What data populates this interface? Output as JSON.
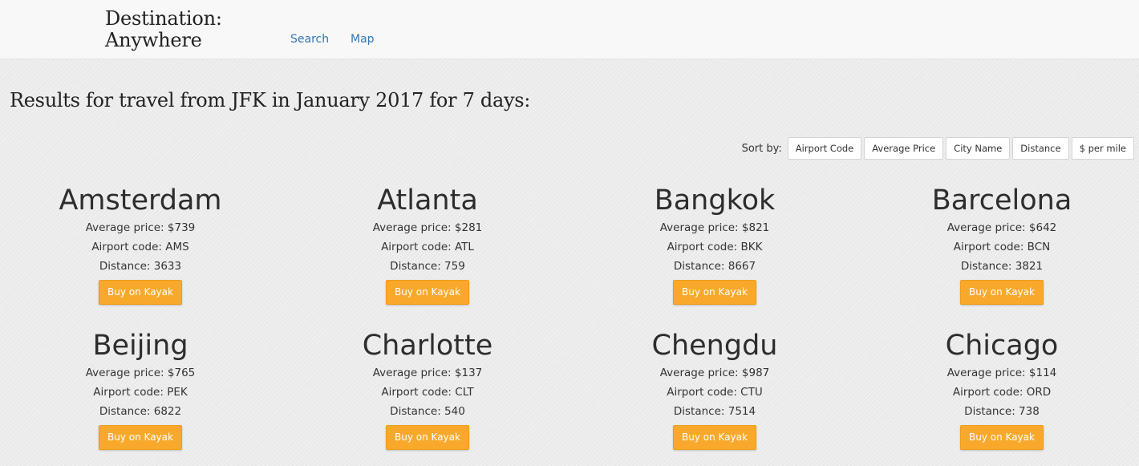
{
  "nav": {
    "brand_line1": "Destination:",
    "brand_line2": "Anywhere",
    "links": [
      "Search",
      "Map"
    ]
  },
  "results_title": "Results for travel from JFK in January 2017 for 7 days:",
  "sort": {
    "label": "Sort by:",
    "options": [
      "Airport Code",
      "Average Price",
      "City Name",
      "Distance",
      "$ per mile"
    ]
  },
  "labels": {
    "price": "Average price: ",
    "code": "Airport code: ",
    "distance": "Distance: ",
    "button": "Buy on Kayak"
  },
  "destinations": [
    {
      "city": "Amsterdam",
      "price": "$739",
      "code": "AMS",
      "distance": "3633"
    },
    {
      "city": "Atlanta",
      "price": "$281",
      "code": "ATL",
      "distance": "759"
    },
    {
      "city": "Bangkok",
      "price": "$821",
      "code": "BKK",
      "distance": "8667"
    },
    {
      "city": "Barcelona",
      "price": "$642",
      "code": "BCN",
      "distance": "3821"
    },
    {
      "city": "Beijing",
      "price": "$765",
      "code": "PEK",
      "distance": "6822"
    },
    {
      "city": "Charlotte",
      "price": "$137",
      "code": "CLT",
      "distance": "540"
    },
    {
      "city": "Chengdu",
      "price": "$987",
      "code": "CTU",
      "distance": "7514"
    },
    {
      "city": "Chicago",
      "price": "$114",
      "code": "ORD",
      "distance": "738"
    }
  ],
  "colors": {
    "kayak_button": "#f8a92b",
    "nav_link": "#3376b3",
    "background": "#ececec"
  }
}
